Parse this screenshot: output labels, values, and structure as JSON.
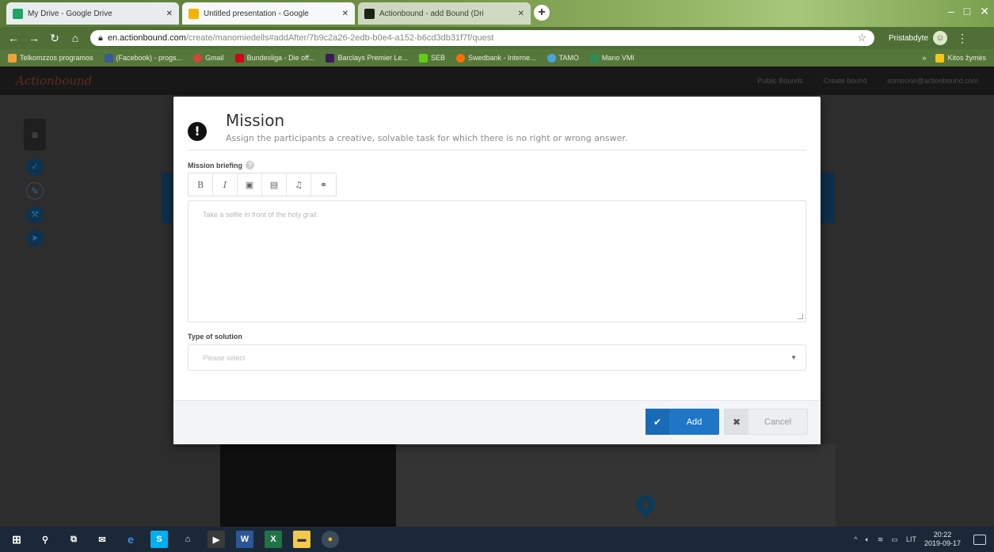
{
  "browser": {
    "tabs": [
      {
        "title": "My Drive - Google Drive",
        "favicon_color": "#1fa463"
      },
      {
        "title": "Untitled presentation - Google",
        "favicon_color": "#f4b400"
      },
      {
        "title": "Actionbound - add Bound (Dri",
        "favicon_color": "#111111"
      }
    ],
    "address": {
      "host": "en.actionbound.com",
      "path": "/create/manomiedells#addAfter/7b9c2a26-2edb-b0e4-a152-b6cd3db31f7f/quest"
    },
    "profile_label": "Pristabdyte",
    "bookmarks": [
      {
        "label": "Telkomzzos programos",
        "color": "#f0a23a"
      },
      {
        "label": "(Facebook) - progs...",
        "color": "#3b5998"
      },
      {
        "label": "Gmail",
        "color": "#d44638"
      },
      {
        "label": "Bundesliga - Die off...",
        "color": "#d20515"
      },
      {
        "label": "Barclays Premier Le...",
        "color": "#3d195b"
      },
      {
        "label": "SEB",
        "color": "#60cd18"
      },
      {
        "label": "Swedbank - Interne...",
        "color": "#ff6f00"
      },
      {
        "label": "TAMO",
        "color": "#4aa3df"
      },
      {
        "label": "Mano VMI",
        "color": "#2e8b57"
      }
    ],
    "bookmarks_other": "Kitos žymės"
  },
  "app": {
    "brand": "Actionbound",
    "header_links": [
      "Public Bounds",
      "Create bound",
      "someone@actionbound.com"
    ]
  },
  "modal": {
    "title": "Mission",
    "subtitle": "Assign the participants a creative, solvable task for which there is no right or wrong answer.",
    "briefing_label": "Mission briefing",
    "briefing_placeholder": "Take a selfie in front of the holy grail.",
    "solution_label": "Type of solution",
    "solution_placeholder": "Please select",
    "add_label": "Add",
    "cancel_label": "Cancel",
    "toolbar": [
      {
        "icon": "bold-icon",
        "glyph": "B"
      },
      {
        "icon": "italic-icon",
        "glyph": "I"
      },
      {
        "icon": "image-icon",
        "glyph": "▣"
      },
      {
        "icon": "video-icon",
        "glyph": "▤"
      },
      {
        "icon": "audio-icon",
        "glyph": "♫"
      },
      {
        "icon": "link-icon",
        "glyph": "⚭"
      }
    ]
  },
  "taskbar": {
    "time": "20:22",
    "date": "2019-09-17",
    "lang": "LIT"
  }
}
